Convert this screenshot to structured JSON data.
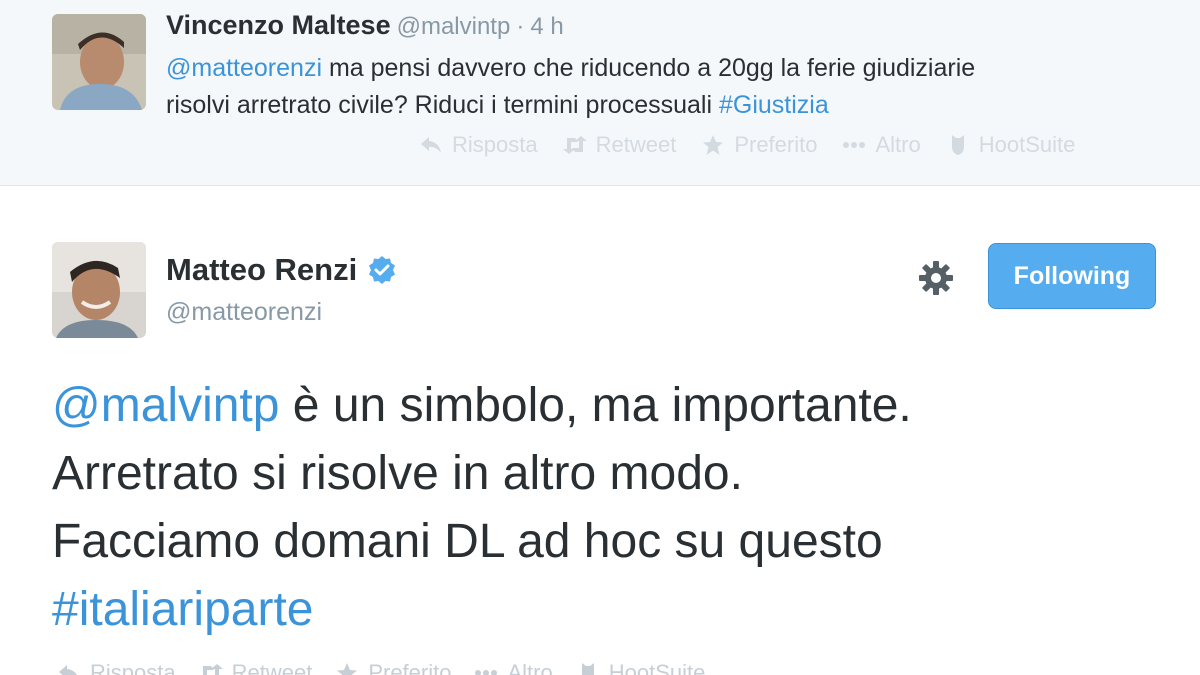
{
  "reply_tweet": {
    "author_name": "Vincenzo Maltese",
    "handle": "@malvintp",
    "separator": "·",
    "time": "4 h",
    "mention": "@matteorenzi",
    "text_line1": " ma pensi davvero che riducendo a 20gg la ferie giudiziarie",
    "text_line2": "risolvi arretrato civile?  Riduci i termini processuali ",
    "hashtag": "#Giustizia",
    "actions": {
      "reply": "Risposta",
      "retweet": "Retweet",
      "favorite": "Preferito",
      "more": "Altro",
      "hootsuite": "HootSuite"
    }
  },
  "main_tweet": {
    "author_name": "Matteo Renzi",
    "handle": "@matteorenzi",
    "follow_label": "Following",
    "mention": "@malvintp",
    "line1_rest": " è un simbolo, ma importante.",
    "line2": "Arretrato si risolve in altro modo.",
    "line3": "Facciamo domani DL ad hoc su questo",
    "hashtag": "#italiariparte",
    "actions": {
      "reply": "Risposta",
      "retweet": "Retweet",
      "favorite": "Preferito",
      "more": "Altro",
      "hootsuite": "HootSuite"
    }
  },
  "colors": {
    "link": "#3b94d9",
    "follow_button": "#55acee",
    "verified": "#55acee",
    "reply_background": "#f5f8fa"
  },
  "icons": {
    "reply": "reply-arrow-icon",
    "retweet": "retweet-icon",
    "favorite": "star-icon",
    "more": "ellipsis-icon",
    "hootsuite": "owl-icon",
    "settings": "gear-icon",
    "verified": "verified-badge-icon"
  }
}
